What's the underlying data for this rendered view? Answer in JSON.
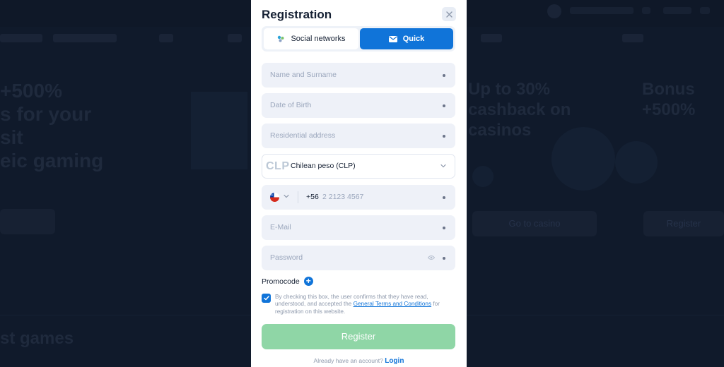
{
  "background": {
    "promo_left": [
      "+500%",
      "s for your",
      "sit",
      "eic gaming"
    ],
    "promo_mid": [
      "Up to 30%",
      "cashback on",
      "casinos"
    ],
    "promo_right": [
      "Bonus",
      "+500%"
    ],
    "cta_mid": "Go to casino",
    "cta_right": "Register",
    "section_title": "st games"
  },
  "modal": {
    "title": "Registration",
    "close_icon": "close-icon",
    "tabs": [
      {
        "label": "Social networks",
        "icon": "social-networks-icon",
        "active": false
      },
      {
        "label": "Quick",
        "icon": "envelope-icon",
        "active": true
      }
    ],
    "fields": {
      "name_placeholder": "Name and Surname",
      "dob_placeholder": "Date of Birth",
      "address_placeholder": "Residential address",
      "currency_code": "CLP",
      "currency_value": "Chilean peso (CLP)",
      "phone_country_code": "+56",
      "phone_placeholder": "2 2123 4567",
      "email_placeholder": "E-Mail",
      "password_placeholder": "Password"
    },
    "promocode_label": "Promocode",
    "consent_part1": "By checking this box, the user confirms that they have read, understood, and accepted the",
    "consent_link": "General Terms and Conditions",
    "consent_part2": "for registration on this website.",
    "register_label": "Register",
    "login_prompt": "Already have an account?",
    "login_link": "Login"
  },
  "colors": {
    "accent": "#1074d9",
    "register_button": "#8fd6a6",
    "field_bg": "#eef1f8"
  }
}
